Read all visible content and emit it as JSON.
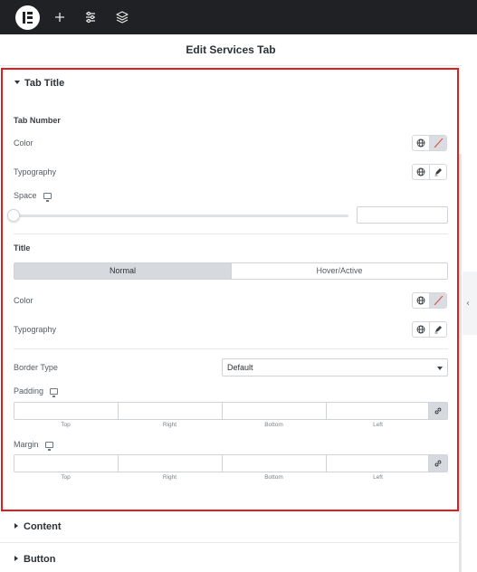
{
  "toolbar": {
    "icons": [
      "elementor-logo-icon",
      "plus-icon",
      "sliders-icon",
      "layers-icon"
    ]
  },
  "panel": {
    "title": "Edit Services Tab"
  },
  "tab_title_section": {
    "heading": "Tab Title",
    "tab_number": {
      "heading": "Tab Number",
      "color_label": "Color",
      "typography_label": "Typography",
      "space_label": "Space",
      "space_value": ""
    },
    "title": {
      "heading": "Title",
      "tabs": [
        "Normal",
        "Hover/Active"
      ],
      "active_tab": "Normal",
      "color_label": "Color",
      "typography_label": "Typography"
    },
    "border_type": {
      "label": "Border Type",
      "value": "Default"
    },
    "padding": {
      "label": "Padding",
      "fields": [
        "Top",
        "Right",
        "Bottom",
        "Left"
      ]
    },
    "margin": {
      "label": "Margin",
      "fields": [
        "Top",
        "Right",
        "Bottom",
        "Left"
      ]
    }
  },
  "collapsed_sections": [
    "Content",
    "Button"
  ],
  "colors": {
    "topbar": "#1f2124",
    "highlight_border": "#e11d1d",
    "active_tab": "#d6d9dd"
  }
}
